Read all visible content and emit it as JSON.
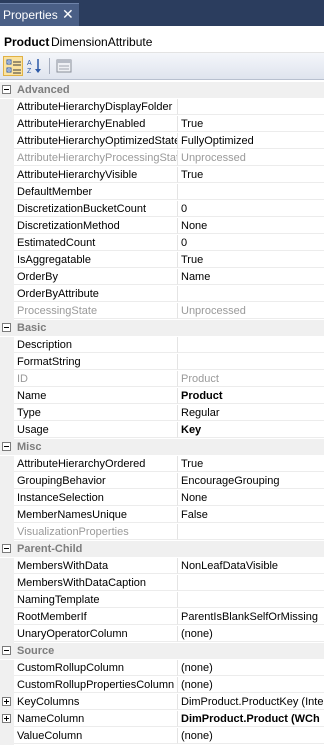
{
  "window": {
    "tab_title": "Properties",
    "close_glyph": "✕"
  },
  "object": {
    "name": "Product",
    "type": "DimensionAttribute"
  },
  "toolbar": {
    "buttons": [
      "categorized-icon",
      "alphabetical-icon",
      "property-pages-icon"
    ]
  },
  "categories": [
    {
      "label": "Advanced",
      "properties": [
        {
          "name": "AttributeHierarchyDisplayFolder",
          "value": ""
        },
        {
          "name": "AttributeHierarchyEnabled",
          "value": "True"
        },
        {
          "name": "AttributeHierarchyOptimizedState",
          "value": "FullyOptimized"
        },
        {
          "name": "AttributeHierarchyProcessingState",
          "value": "Unprocessed"
        },
        {
          "name": "AttributeHierarchyVisible",
          "value": "True"
        },
        {
          "name": "DefaultMember",
          "value": ""
        },
        {
          "name": "DiscretizationBucketCount",
          "value": "0"
        },
        {
          "name": "DiscretizationMethod",
          "value": "None"
        },
        {
          "name": "EstimatedCount",
          "value": "0"
        },
        {
          "name": "IsAggregatable",
          "value": "True"
        },
        {
          "name": "OrderBy",
          "value": "Name"
        },
        {
          "name": "OrderByAttribute",
          "value": ""
        },
        {
          "name": "ProcessingState",
          "value": "Unprocessed"
        }
      ]
    },
    {
      "label": "Basic",
      "properties": [
        {
          "name": "Description",
          "value": ""
        },
        {
          "name": "FormatString",
          "value": ""
        },
        {
          "name": "ID",
          "value": "Product"
        },
        {
          "name": "Name",
          "value": "Product"
        },
        {
          "name": "Type",
          "value": "Regular"
        },
        {
          "name": "Usage",
          "value": "Key"
        }
      ]
    },
    {
      "label": "Misc",
      "properties": [
        {
          "name": "AttributeHierarchyOrdered",
          "value": "True"
        },
        {
          "name": "GroupingBehavior",
          "value": "EncourageGrouping"
        },
        {
          "name": "InstanceSelection",
          "value": "None"
        },
        {
          "name": "MemberNamesUnique",
          "value": "False"
        },
        {
          "name": "VisualizationProperties",
          "value": ""
        }
      ]
    },
    {
      "label": "Parent-Child",
      "properties": [
        {
          "name": "MembersWithData",
          "value": "NonLeafDataVisible"
        },
        {
          "name": "MembersWithDataCaption",
          "value": ""
        },
        {
          "name": "NamingTemplate",
          "value": ""
        },
        {
          "name": "RootMemberIf",
          "value": "ParentIsBlankSelfOrMissing"
        },
        {
          "name": "UnaryOperatorColumn",
          "value": "(none)"
        }
      ]
    },
    {
      "label": "Source",
      "properties": [
        {
          "name": "CustomRollupColumn",
          "value": "(none)"
        },
        {
          "name": "CustomRollupPropertiesColumn",
          "value": "(none)"
        },
        {
          "name": "KeyColumns",
          "value": "DimProduct.ProductKey (Inte"
        },
        {
          "name": "NameColumn",
          "value": "DimProduct.Product (WCh"
        },
        {
          "name": "ValueColumn",
          "value": "(none)"
        }
      ]
    }
  ]
}
